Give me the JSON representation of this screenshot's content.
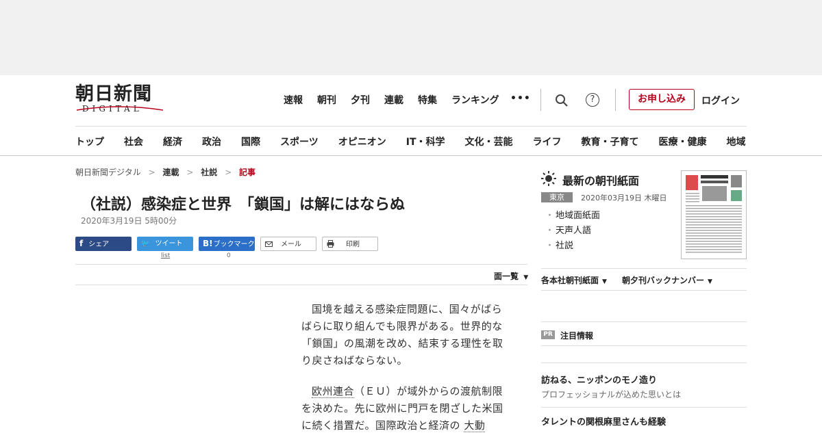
{
  "header": {
    "logo_jp": "朝日新聞",
    "logo_en": "DIGITAL",
    "topnav": [
      "速報",
      "朝刊",
      "夕刊",
      "連載",
      "特集",
      "ランキング"
    ],
    "more": "•••",
    "help_glyph": "?",
    "apply_label": "お申し込み",
    "login_label": "ログイン",
    "categories": [
      "トップ",
      "社会",
      "経済",
      "政治",
      "国際",
      "スポーツ",
      "オピニオン",
      "IT・科学",
      "文化・芸能",
      "ライフ",
      "教育・子育て",
      "医療・健康",
      "地域"
    ]
  },
  "breadcrumb": {
    "home": "朝日新聞デジタル",
    "level1": "連載",
    "level2": "社説",
    "current": "記事",
    "separator": ">"
  },
  "article": {
    "title": "（社説）感染症と世界　「鎖国」は解にはならぬ",
    "date": "2020年3月19日 5時00分",
    "share": {
      "facebook_icon": "f",
      "facebook_label": "シェア",
      "twitter_icon": "🐦",
      "twitter_label": "ツイート",
      "twitter_count": "list",
      "hatena_icon": "B!",
      "hatena_label": "ブックマーク",
      "hatena_count": "0",
      "mail_label": "メール",
      "print_label": "印刷"
    },
    "list_all": "面一覧",
    "paragraph1": "国境を越える感染症問題に、国々がばらばらに取り組んでも限界がある。世界的な「鎖国」の風潮を改め、結束する理性を取り戻さねばならない。",
    "paragraph2_underlined": "欧州連合",
    "paragraph2_rest": "（ＥＵ）が域外からの渡航制限を決めた。先に欧州に門戸を閉ざした米国に続く措置だ。国際政治と経済の ",
    "paragraph2_underlined2": "大動"
  },
  "sidebar": {
    "title": "最新の朝刊紙面",
    "region": "東京",
    "date": "2020年03月19日 木曜日",
    "links": [
      "地域面紙面",
      "天声人語",
      "社説"
    ],
    "menu1": "各本社朝刊紙面",
    "menu2": "朝夕刊バックナンバー",
    "pr_badge": "PR",
    "pr_title": "注目情報",
    "pr_items": [
      {
        "title": "訪ねる、ニッポンのモノ造り",
        "sub": "プロフェッショナルが込めた思いとは"
      },
      {
        "title": "タレントの関根麻里さんも経験",
        "sub": ""
      }
    ]
  },
  "colors": {
    "accent": "#b8001a",
    "facebook": "#2c4a86",
    "twitter": "#3b95dd",
    "hatena": "#2b6fc9"
  }
}
